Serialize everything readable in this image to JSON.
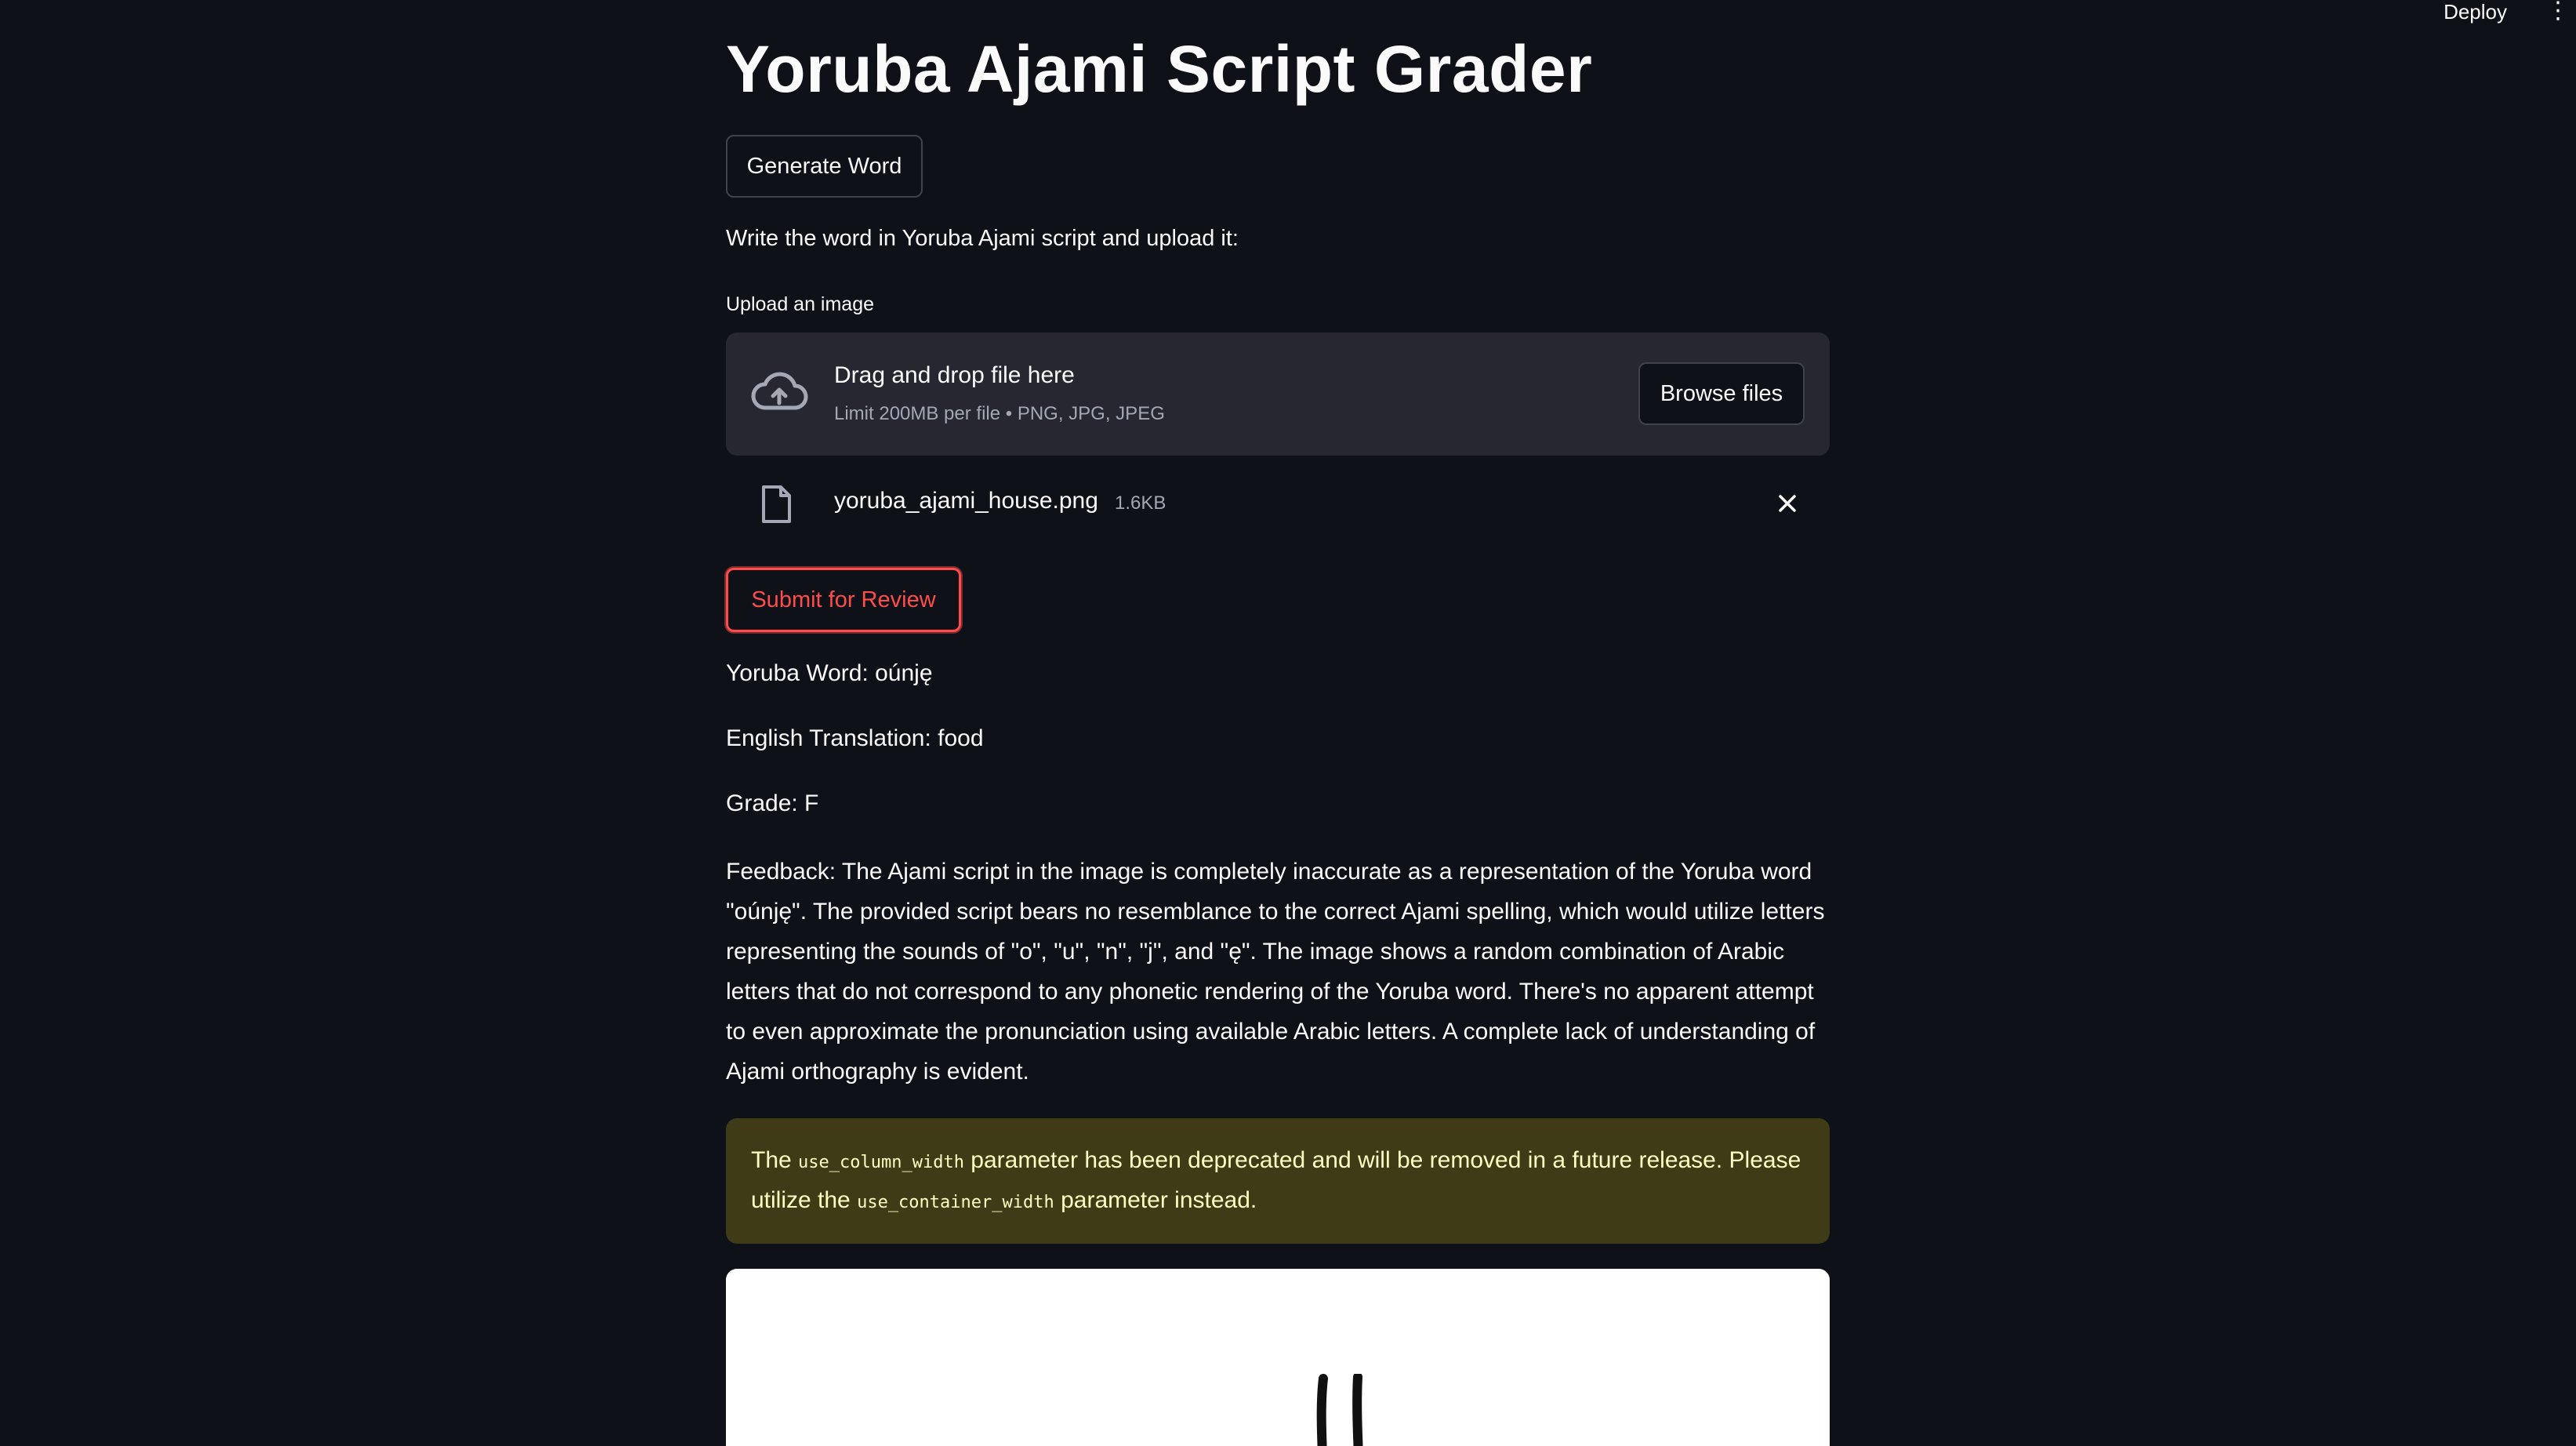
{
  "header": {
    "deploy_label": "Deploy",
    "menu_icon": "more-vertical-icon"
  },
  "app": {
    "title": "Yoruba Ajami Script Grader",
    "generate_button": "Generate Word",
    "instruction": "Write the word in Yoruba Ajami script and upload it:"
  },
  "uploader": {
    "label": "Upload an image",
    "drop_title": "Drag and drop file here",
    "drop_subtitle": "Limit 200MB per file • PNG, JPG, JPEG",
    "browse_button": "Browse files",
    "icon": "cloud-upload-icon",
    "file": {
      "name": "yoruba_ajami_house.png",
      "size": "1.6KB",
      "icon": "file-icon",
      "remove_icon": "close-icon"
    }
  },
  "submit_button": "Submit for Review",
  "results": {
    "word": "Yoruba Word: oúnję",
    "translation": "English Translation: food",
    "grade": "Grade: F",
    "feedback": "Feedback: The Ajami script in the image is completely inaccurate as a representation of the Yoruba word \"oúnję\". The provided script bears no resemblance to the correct Ajami spelling, which would utilize letters representing the sounds of \"o\", \"u\", \"n\", \"j\", and \"ę\". The image shows a random combination of Arabic letters that do not correspond to any phonetic rendering of the Yoruba word. There's no apparent attempt to even approximate the pronunciation using available Arabic letters. A complete lack of understanding of Ajami orthography is evident."
  },
  "warning": {
    "part1": "The ",
    "code1": "use_column_width",
    "part2": " parameter has been deprecated and will be removed in a future release. Please utilize the ",
    "code2": "use_container_width",
    "part3": " parameter instead."
  },
  "colors": {
    "background": "#0e1117",
    "dropzone": "#262730",
    "accent": "#ff4b4b",
    "warning_bg": "#3e3b16",
    "warning_text": "#ffffc2"
  }
}
